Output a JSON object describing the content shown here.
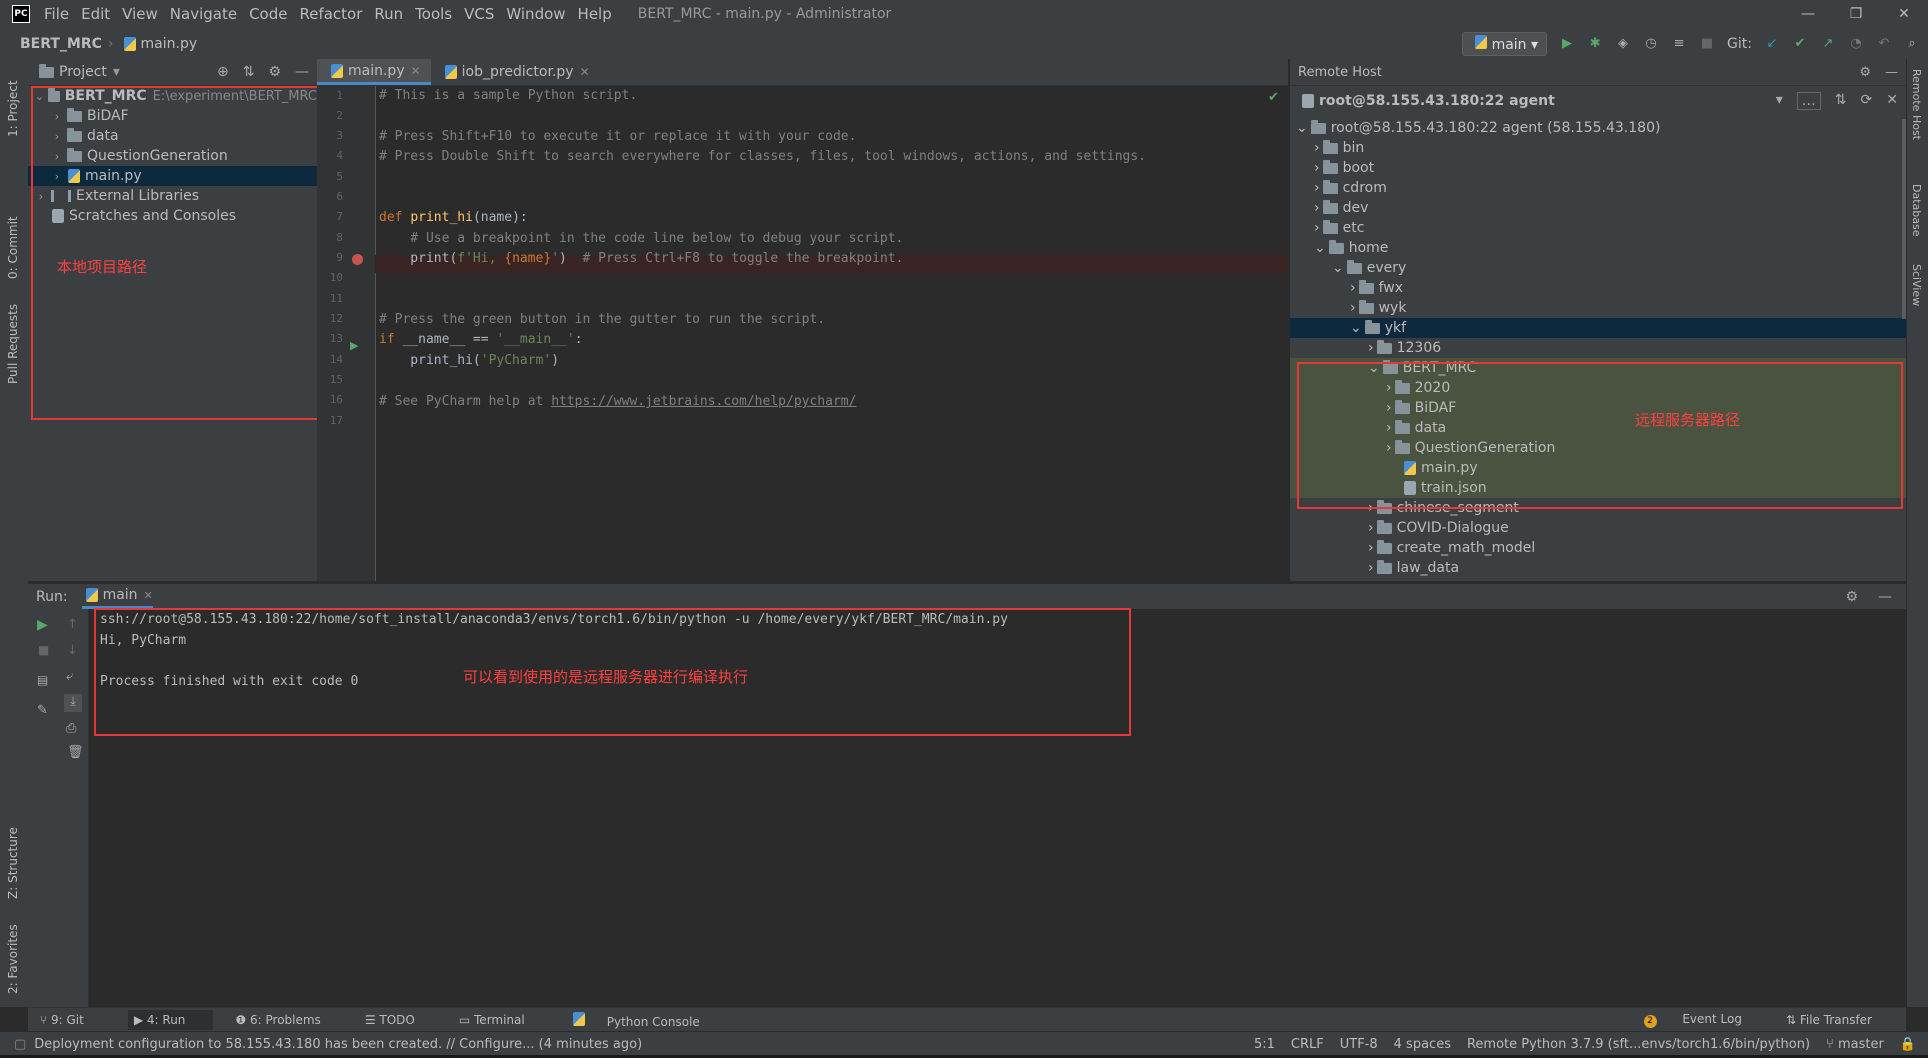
{
  "window": {
    "app_logo": "PC",
    "menu": [
      "File",
      "Edit",
      "View",
      "Navigate",
      "Code",
      "Refactor",
      "Run",
      "Tools",
      "VCS",
      "Window",
      "Help"
    ],
    "title": "BERT_MRC - main.py - Administrator",
    "controls": [
      "—",
      "❐",
      "✕"
    ]
  },
  "navbar": {
    "project": "BERT_MRC",
    "file": "main.py",
    "run_config": "main",
    "git_label": "Git:"
  },
  "left_stripe": {
    "tabs": [
      "1: Project",
      "0: Commit",
      "Pull Requests",
      "Z: Structure",
      "2: Favorites"
    ]
  },
  "right_stripe": {
    "tabs": [
      "Remote Host",
      "Database",
      "SciView"
    ]
  },
  "project": {
    "header": "Project",
    "root_name": "BERT_MRC",
    "root_path": "E:\\experiment\\BERT_MRC",
    "items": [
      "BiDAF",
      "data",
      "QuestionGeneration",
      "main.py"
    ],
    "external": "External Libraries",
    "scratches": "Scratches and Consoles",
    "annotation": "本地项目路径"
  },
  "editor": {
    "tabs": [
      "main.py",
      "iob_predictor.py"
    ],
    "line_numbers": [
      "1",
      "2",
      "3",
      "4",
      "5",
      "6",
      "7",
      "8",
      "9",
      "10",
      "11",
      "12",
      "13",
      "14",
      "15",
      "16",
      "17"
    ],
    "l1": "# This is a sample Python script.",
    "l3": "# Press Shift+F10 to execute it or replace it with your code.",
    "l4": "# Press Double Shift to search everywhere for classes, files, tool windows, actions, and settings.",
    "l7_kw": "def ",
    "l7_fn": "print_hi",
    "l7_rest": "(name):",
    "l8": "    # Use a breakpoint in the code line below to debug your script.",
    "l9_a": "    print(",
    "l9_s1": "f'Hi, ",
    "l9_b": "{name}",
    "l9_s2": "'",
    "l9_c": ")  ",
    "l9_cm": "# Press Ctrl+F8 to toggle the breakpoint.",
    "l12": "# Press the green button in the gutter to run the script.",
    "l13_kw": "if ",
    "l13_a": "__name__ == ",
    "l13_s": "'__main__'",
    "l13_b": ":",
    "l14_a": "    print_hi(",
    "l14_s": "'PyCharm'",
    "l14_b": ")",
    "l16_cm": "# See PyCharm help at ",
    "l16_link": "https://www.jetbrains.com/help/pycharm/"
  },
  "remote": {
    "header": "Remote Host",
    "server": "root@58.155.43.180:22 agent",
    "root": "root@58.155.43.180:22 agent (58.155.43.180)",
    "top_dirs": [
      "bin",
      "boot",
      "cdrom",
      "dev",
      "etc",
      "home"
    ],
    "every": "every",
    "every_dirs": [
      "fwx",
      "wyk",
      "ykf"
    ],
    "ykf_dirs": [
      "12306",
      "BERT_MRC"
    ],
    "bert_dirs": [
      "2020",
      "BiDAF",
      "data",
      "QuestionGeneration"
    ],
    "bert_files": [
      "main.py",
      "train.json"
    ],
    "more_dirs": [
      "chinese_segment",
      "COVID-Dialogue",
      "create_math_model",
      "law_data"
    ],
    "annotation": "远程服务器路径"
  },
  "run": {
    "label": "Run:",
    "tab": "main",
    "line1": "ssh://root@58.155.43.180:22/home/soft_install/anaconda3/envs/torch1.6/bin/python -u /home/every/ykf/BERT_MRC/main.py",
    "line2": "Hi, PyCharm",
    "line3": "Process finished with exit code 0",
    "annotation": "可以看到使用的是远程服务器进行编译执行"
  },
  "toolwindows": [
    "9: Git",
    "4: Run",
    "6: Problems",
    "TODO",
    "Terminal",
    "Python Console",
    "Event Log",
    "File Transfer"
  ],
  "event_log_count": "2",
  "status": {
    "message": "Deployment configuration to 58.155.43.180 has been created. // Configure... (4 minutes ago)",
    "position": "5:1",
    "line_sep": "CRLF",
    "encoding": "UTF-8",
    "indent": "4 spaces",
    "interpreter": "Remote Python 3.7.9 (sft...envs/torch1.6/bin/python)",
    "branch": "master"
  }
}
